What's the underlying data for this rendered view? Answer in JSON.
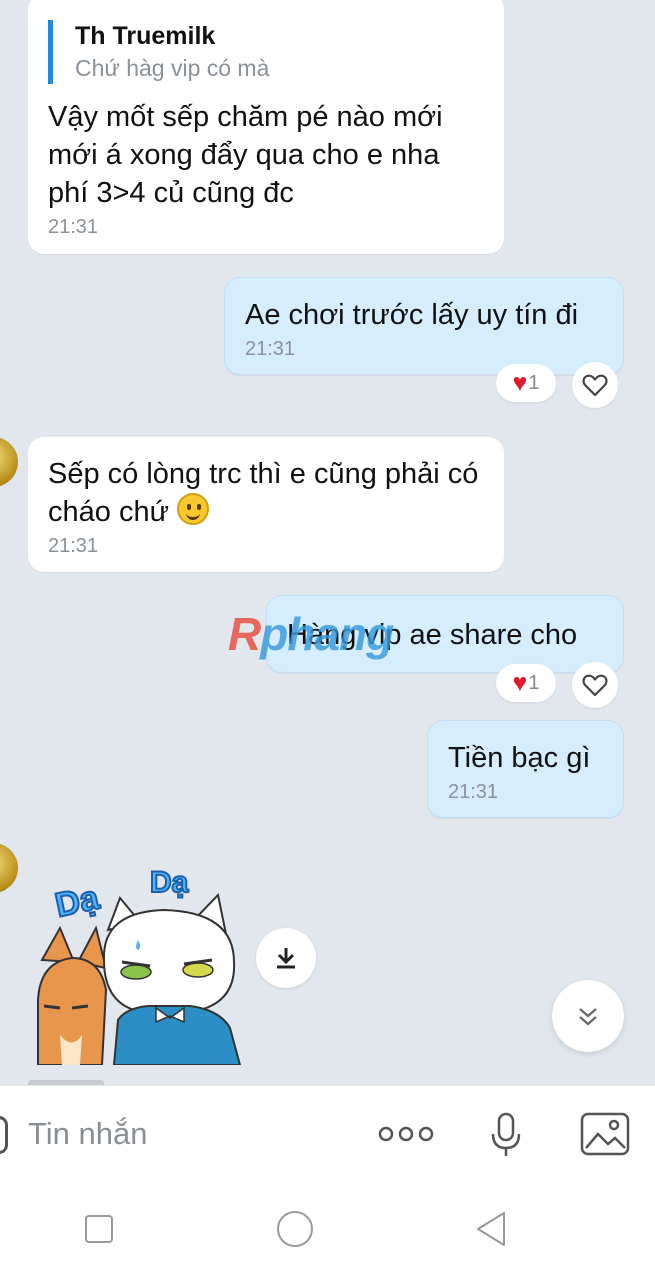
{
  "messages": [
    {
      "quote": {
        "author": "Th Truemilk",
        "text": "Chứ hàg vip có mà"
      },
      "text": "Vậy mốt sếp chăm pé nào mới mới á xong đẩy qua cho e nha phí  3>4 củ cũng đc",
      "time": "21:31"
    },
    {
      "text": "Ae chơi trước lấy uy tín đi",
      "time": "21:31",
      "reaction_count": "1"
    },
    {
      "text": "Sếp có lòng trc thì e cũng phải có cháo chứ",
      "time": "21:31"
    },
    {
      "text": "Hàng vip ae share cho",
      "reaction_count": "1"
    },
    {
      "text": "Tiền bạc gì",
      "time": "21:31"
    }
  ],
  "sticker": {
    "text_left": "Dạ",
    "text_right": "Dạ"
  },
  "watermark": {
    "part1": "R",
    "part2": "phang"
  },
  "composer": {
    "placeholder": "Tin nhắn"
  },
  "colors": {
    "outgoing_bubble": "#d6edfd",
    "incoming_bubble": "#ffffff",
    "background": "#e2e7ee",
    "quote_bar": "#1e88e5",
    "reaction_heart": "#e0192b"
  },
  "icons": [
    "heart-outline-icon",
    "heart-filled-icon",
    "download-icon",
    "chevron-double-down-icon",
    "more-icon",
    "microphone-icon",
    "image-icon",
    "square-nav-icon",
    "circle-nav-icon",
    "back-nav-icon",
    "smile-emoji-icon"
  ]
}
